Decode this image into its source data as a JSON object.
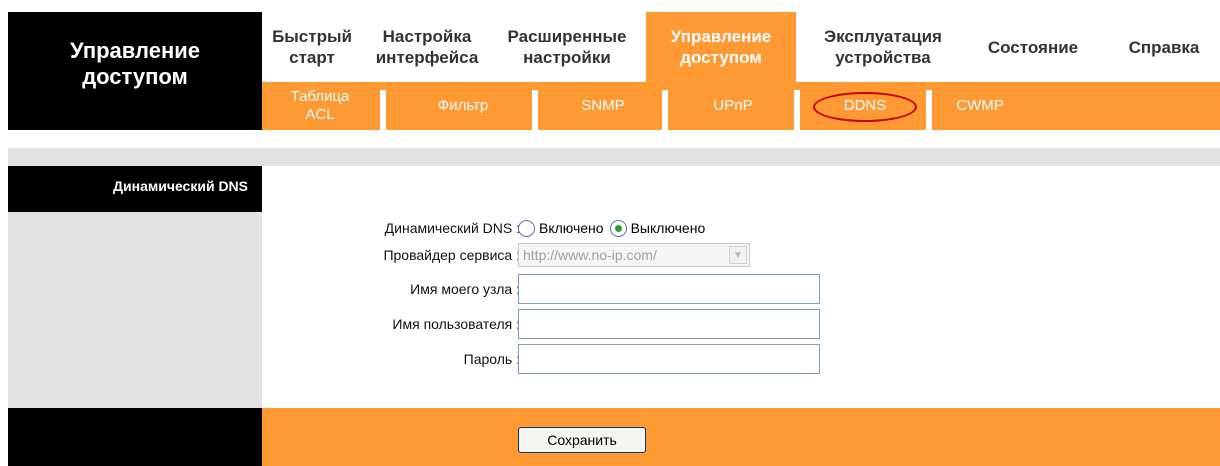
{
  "brand": {
    "line1": "Управление",
    "line2": "доступом"
  },
  "topnav": [
    {
      "line1": "Быстрый",
      "line2": "старт"
    },
    {
      "line1": "Настройка",
      "line2": "интерфейса"
    },
    {
      "line1": "Расширенные",
      "line2": "настройки"
    },
    {
      "line1": "Управление",
      "line2": "доступом",
      "active": true
    },
    {
      "line1": "Эксплуатация",
      "line2": "устройства"
    },
    {
      "line1": "Состояние",
      "line2": ""
    },
    {
      "line1": "Справка",
      "line2": ""
    }
  ],
  "subnav": [
    {
      "line1": "Таблица",
      "line2": "ACL"
    },
    {
      "line1": "Фильтр"
    },
    {
      "line1": "SNMP"
    },
    {
      "line1": "UPnP"
    },
    {
      "line1": "DDNS",
      "selected": true
    },
    {
      "line1": "CWMP"
    }
  ],
  "section": {
    "title": "Динамический DNS"
  },
  "form": {
    "ddns_label": "Динамический DNS :",
    "ddns_options": [
      "Включено",
      "Выключено"
    ],
    "ddns_selected": "Выключено",
    "provider_label": "Провайдер сервиса :",
    "provider_value": "http://www.no-ip.com/",
    "hostname_label": "Имя моего узла :",
    "hostname_value": "",
    "username_label": "Имя пользователя :",
    "username_value": "",
    "password_label": "Пароль :",
    "password_value": ""
  },
  "footer": {
    "save_label": "Сохранить"
  },
  "colors": {
    "accent": "#ff9933",
    "dark": "#000000",
    "grey": "#e1e1e1",
    "highlight": "#cc0000"
  }
}
